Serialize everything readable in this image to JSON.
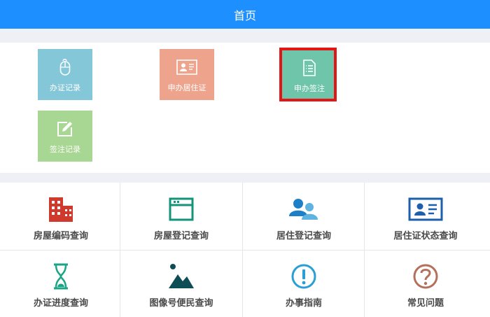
{
  "header": {
    "title": "首页"
  },
  "tiles": [
    {
      "label": "办证记录",
      "icon": "mouse-icon",
      "color": "#84c7d8"
    },
    {
      "label": "申办居住证",
      "icon": "id-card-icon",
      "color": "#eea48c"
    },
    {
      "label": "申办签注",
      "icon": "document-icon",
      "color": "#6fc5a9",
      "selected": true
    },
    {
      "label": "签注记录",
      "icon": "edit-icon",
      "color": "#a8d693"
    }
  ],
  "services": [
    {
      "label": "房屋编码查询",
      "icon": "building-icon",
      "color": "#d03a2c"
    },
    {
      "label": "房屋登记查询",
      "icon": "browser-window-icon",
      "color": "#12937a"
    },
    {
      "label": "居住登记查询",
      "icon": "users-icon",
      "color": "#1e7fc9"
    },
    {
      "label": "居住证状态查询",
      "icon": "id-card-icon",
      "color": "#1e5fab"
    },
    {
      "label": "办证进度查询",
      "icon": "hourglass-icon",
      "color": "#1aa584"
    },
    {
      "label": "图像号便民查询",
      "icon": "image-icon",
      "color": "#0e4d55"
    },
    {
      "label": "办事指南",
      "icon": "info-icon",
      "color": "#2a9fd6"
    },
    {
      "label": "常见问题",
      "icon": "question-icon",
      "color": "#b5705c"
    }
  ]
}
